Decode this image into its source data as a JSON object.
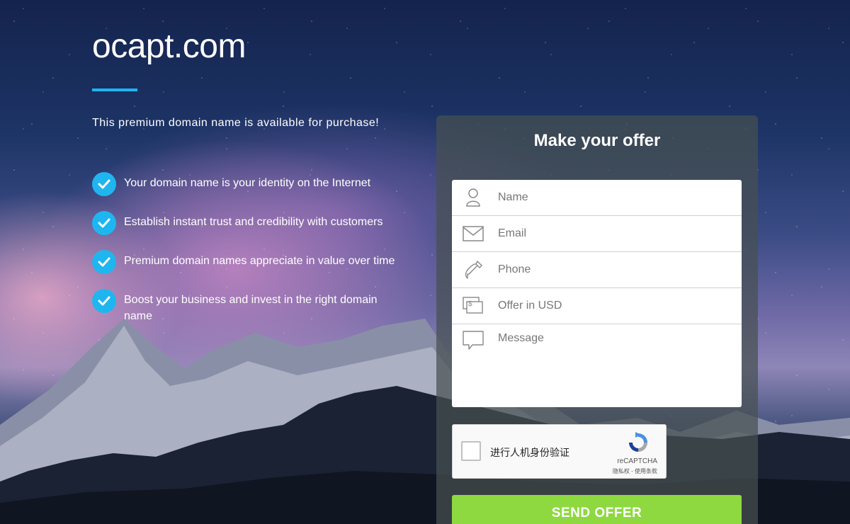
{
  "site": {
    "domain": "ocapt.com",
    "tagline": "This premium domain name is available for purchase!"
  },
  "features": [
    "Your domain name is your identity on the Internet",
    "Establish instant trust and credibility with customers",
    "Premium domain names appreciate in value over time",
    "Boost your business and invest in the right domain name"
  ],
  "offer_form": {
    "title": "Make your offer",
    "name_placeholder": "Name",
    "email_placeholder": "Email",
    "phone_placeholder": "Phone",
    "offer_placeholder": "Offer in USD",
    "message_placeholder": "Message",
    "submit_label": "SEND OFFER"
  },
  "captcha": {
    "label": "进行人机身份验证",
    "brand": "reCAPTCHA",
    "links": "隐私权 - 使用条款"
  },
  "colors": {
    "accent": "#1fb6f0",
    "submit": "#8ed940",
    "panel": "rgba(70,80,80,0.72)"
  },
  "icons": [
    "check-icon",
    "user-icon",
    "envelope-icon",
    "phone-icon",
    "money-icon",
    "message-icon",
    "recaptcha-icon"
  ]
}
